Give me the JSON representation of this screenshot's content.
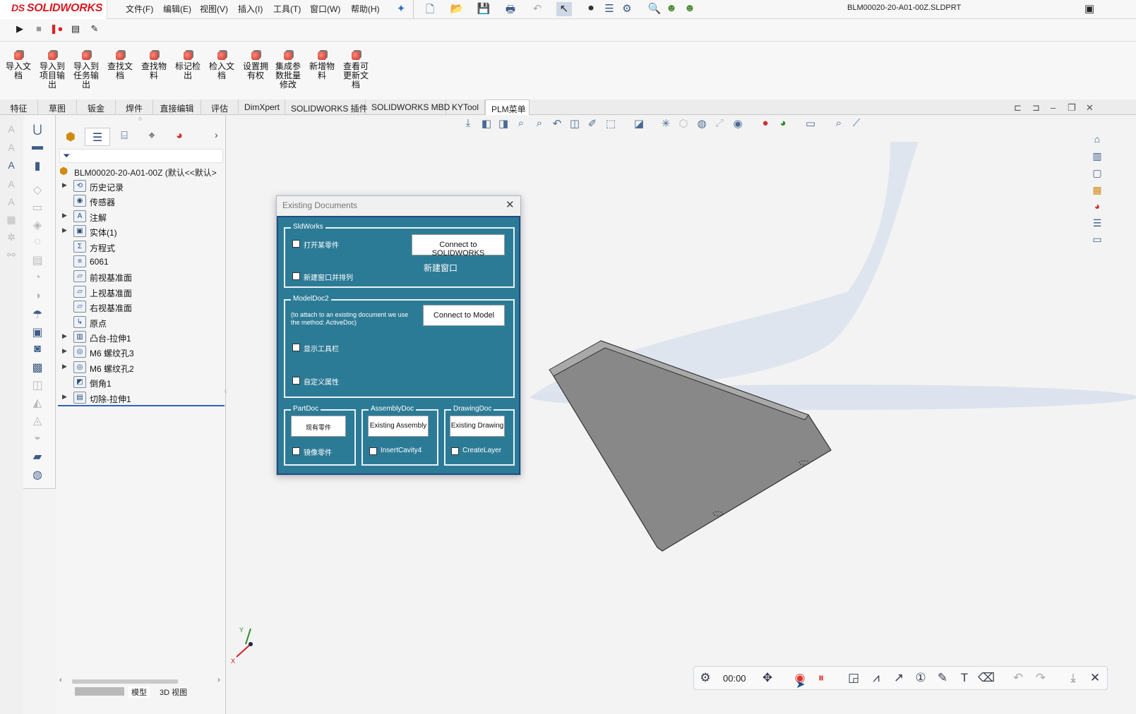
{
  "app": {
    "logo_text": "SOLIDWORKS",
    "logo_prefix": "DS",
    "document_title": "BLM00020-20-A01-00Z.SLDPRT",
    "brand_color": "#d71920"
  },
  "menu": [
    "文件(F)",
    "编辑(E)",
    "视图(V)",
    "插入(I)",
    "工具(T)",
    "窗口(W)",
    "帮助(H)"
  ],
  "plm_commands": [
    "导入文档",
    "导入到项目输出",
    "导入到任务输出",
    "查找文档",
    "查找物料",
    "标记检出",
    "检入文档",
    "设置拥有权",
    "集成参数批量修改",
    "新增物料",
    "查看可更新文档"
  ],
  "command_tabs": [
    "特征",
    "草图",
    "钣金",
    "焊件",
    "直接编辑",
    "评估",
    "DimXpert",
    "SOLIDWORKS 插件",
    "SOLIDWORKS MBD",
    "KYTool",
    "PLM菜单"
  ],
  "active_tab": "PLM菜单",
  "tree": {
    "root": "BLM00020-20-A01-00Z  (默认<<默认>",
    "items": [
      {
        "label": "历史记录",
        "expandable": true,
        "icon": "history-icon"
      },
      {
        "label": "传感器",
        "expandable": false,
        "icon": "sensor-icon"
      },
      {
        "label": "注解",
        "expandable": true,
        "icon": "annotation-icon"
      },
      {
        "label": "实体(1)",
        "expandable": true,
        "icon": "solid-bodies-icon"
      },
      {
        "label": "方程式",
        "expandable": false,
        "icon": "equations-icon"
      },
      {
        "label": "6061",
        "expandable": false,
        "icon": "material-icon"
      },
      {
        "label": "前视基准面",
        "expandable": false,
        "icon": "plane-icon"
      },
      {
        "label": "上视基准面",
        "expandable": false,
        "icon": "plane-icon"
      },
      {
        "label": "右视基准面",
        "expandable": false,
        "icon": "plane-icon"
      },
      {
        "label": "原点",
        "expandable": false,
        "icon": "origin-icon"
      },
      {
        "label": "凸台-拉伸1",
        "expandable": true,
        "icon": "extrude-icon"
      },
      {
        "label": "M6 螺纹孔3",
        "expandable": true,
        "icon": "hole-icon"
      },
      {
        "label": "M6 螺纹孔2",
        "expandable": true,
        "icon": "hole-icon"
      },
      {
        "label": "倒角1",
        "expandable": false,
        "icon": "chamfer-icon"
      },
      {
        "label": "切除-拉伸1",
        "expandable": true,
        "icon": "cut-extrude-icon"
      }
    ]
  },
  "dialog": {
    "title": "Existing Documents",
    "sldworks": {
      "group_title": "SldWorks",
      "cb_open": "打开某零件",
      "cb_new_window": "新建窗口并排列",
      "connect_button": "Connect to SOLIDWORKS",
      "new_window_label": "新建窗口"
    },
    "modeldoc": {
      "group_title": "ModelDoc2",
      "note": "(to attach to an existing document we use the method: ActiveDoc)",
      "connect_button": "Connect to Model",
      "cb_toolbar": "显示工具栏",
      "cb_props": "自定义属性"
    },
    "partdoc": {
      "group_title": "PartDoc",
      "button": "现有零件",
      "checkbox": "镜像零件"
    },
    "assemblydoc": {
      "group_title": "AssemblyDoc",
      "button": "Existing Assembly",
      "checkbox": "InsertCavity4"
    },
    "drawingdoc": {
      "group_title": "DrawingDoc",
      "button": "Existing Drawing",
      "checkbox": "CreateLayer"
    },
    "panel_color": "#2c7b96"
  },
  "recorder": {
    "time": "00:00"
  },
  "bottom_tabs": [
    "模型",
    "3D 视图"
  ],
  "triad": {
    "x": "X",
    "y": "Y"
  }
}
